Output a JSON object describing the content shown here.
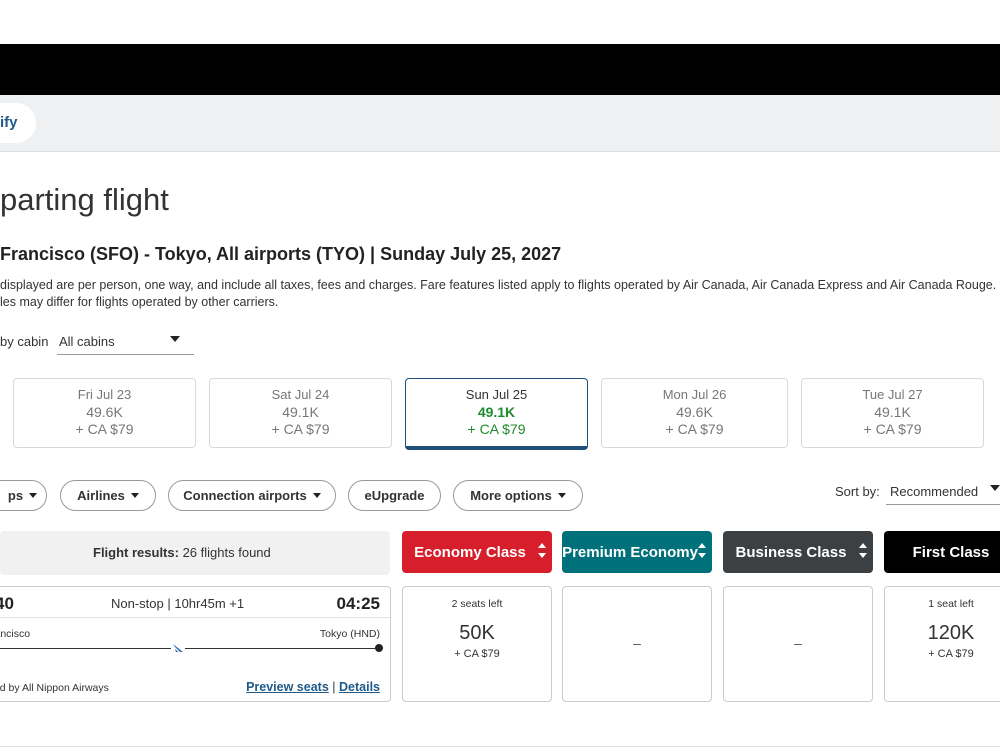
{
  "header": {
    "modify_label": "ify"
  },
  "page": {
    "title": "parting flight",
    "route": "Francisco (SFO) - Tokyo, All airports (TYO)  |  Sunday July 25, 2027",
    "disclaimer_line1": "displayed are per person, one way, and include all taxes, fees and charges. Fare features listed apply to flights operated by Air Canada, Air Canada Express and Air Canada Rouge. Poli",
    "disclaimer_line2": "les may differ for flights operated by other carriers."
  },
  "cabin_filter": {
    "label": "by cabin",
    "value": "All cabins"
  },
  "dates": [
    {
      "day": "Fri Jul 23",
      "points": "49.6K",
      "fee": "+ CA $79",
      "active": false
    },
    {
      "day": "Sat Jul 24",
      "points": "49.1K",
      "fee": "+ CA $79",
      "active": false
    },
    {
      "day": "Sun Jul 25",
      "points": "49.1K",
      "fee": "+ CA $79",
      "active": true
    },
    {
      "day": "Mon Jul 26",
      "points": "49.6K",
      "fee": "+ CA $79",
      "active": false
    },
    {
      "day": "Tue Jul 27",
      "points": "49.1K",
      "fee": "+ CA $79",
      "active": false
    }
  ],
  "filters": {
    "stops": "ps",
    "airlines": "Airlines",
    "connection": "Connection airports",
    "eupgrade": "eUpgrade",
    "more": "More options"
  },
  "sort": {
    "label": "Sort by:",
    "value": "Recommended"
  },
  "results": {
    "label": "Flight results:",
    "count": "26 flights found"
  },
  "cabins": [
    {
      "label": "Economy Class",
      "color": "#d71f2b"
    },
    {
      "label": "Premium Economy",
      "color": "#00707a"
    },
    {
      "label": "Business Class",
      "color": "#3c4043"
    },
    {
      "label": "First Class",
      "color": "#000000"
    }
  ],
  "flight": {
    "depart_time": "40",
    "arrive_time": "04:25",
    "duration": "Non-stop | 10hr45m +1",
    "from": "rancisco",
    "to": "Tokyo (HND)",
    "operated": "ted by All Nippon Airways",
    "preview_seats": "Preview seats",
    "separator": "|",
    "details": "Details",
    "fares": [
      {
        "seats": "2 seats left",
        "amount": "50K",
        "fee": "+ CA $79",
        "available": true
      },
      {
        "dash": "–",
        "available": false
      },
      {
        "dash": "–",
        "available": false
      },
      {
        "seats": "1 seat left",
        "amount": "120K",
        "fee": "+ CA $79",
        "available": true
      }
    ]
  }
}
